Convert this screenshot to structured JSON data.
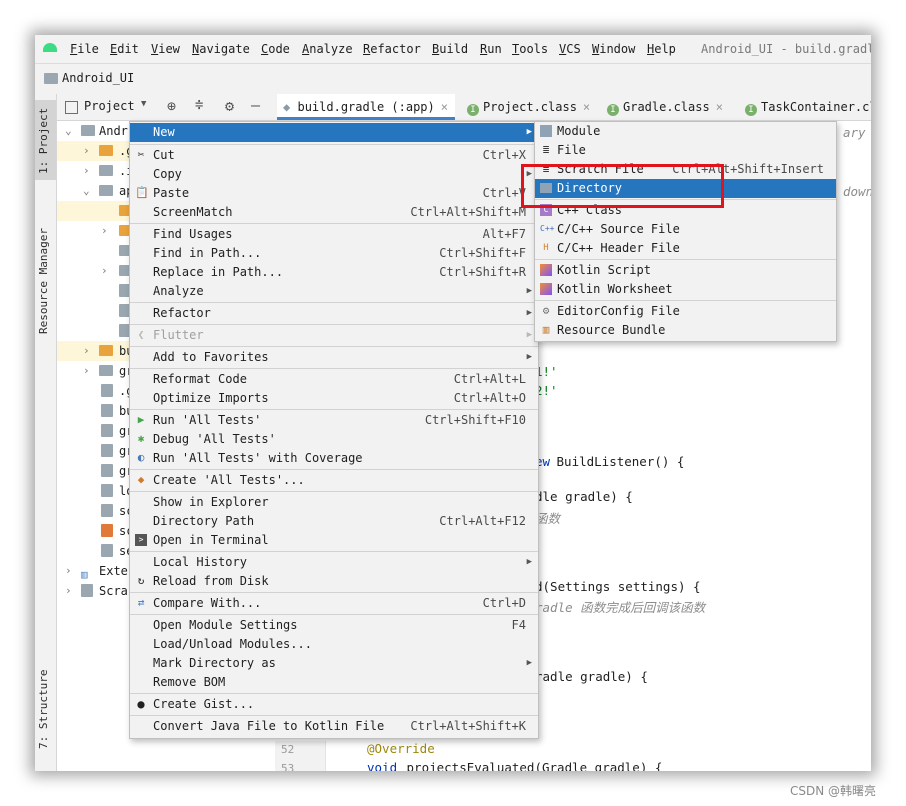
{
  "menubar": {
    "items": [
      "File",
      "Edit",
      "View",
      "Navigate",
      "Code",
      "Analyze",
      "Refactor",
      "Build",
      "Run",
      "Tools",
      "VCS",
      "Window",
      "Help"
    ],
    "window_title": "Android_UI - build.gradl"
  },
  "navbar": {
    "project_name": "Android_UI"
  },
  "left_stripe": {
    "project_tab": "1: Project",
    "resource_tab": "Resource Manager",
    "structure_tab": "7: Structure"
  },
  "project_toolbar": {
    "view_label": "Project"
  },
  "tabs": [
    {
      "label": "build.gradle (:app)",
      "icon": "gradle-icon"
    },
    {
      "label": "Project.class",
      "icon": "class-icon"
    },
    {
      "label": "Gradle.class",
      "icon": "class-icon"
    },
    {
      "label": "TaskContainer.cl",
      "icon": "class-icon"
    }
  ],
  "tree": {
    "root_label": "Andr",
    "rows": [
      "",
      ".g",
      ".i",
      "ap",
      "",
      "",
      "",
      "",
      "",
      "bu",
      "gr",
      ".g",
      "bu",
      "gr",
      "gr",
      "gr",
      "lo",
      "sc",
      "sc",
      "se",
      "Exte",
      "Scra"
    ]
  },
  "editor": {
    "lines": {
      "l1": "ary f",
      "l2": "down",
      "l3": "1!'",
      "l4": "2!'",
      "l5a": "ew",
      "l5b": " BuildListener() {",
      "l6": "dle gradle) {",
      "l7": "函数",
      "l8": "d(Settings settings) {",
      "l9": "radle 函数完成后回调该函数",
      "l10": "radle gradle) {",
      "l11": "@Override",
      "l12a": "void",
      "l12b": " projectsEvaluated(Gradle gradle) {"
    },
    "line_numbers": [
      "52",
      "53"
    ]
  },
  "context_menu": {
    "items": [
      {
        "label": "New",
        "shortcut": "",
        "submenu": true,
        "icon": ""
      },
      {
        "label": "Cut",
        "shortcut": "Ctrl+X",
        "icon": "scissors-icon"
      },
      {
        "label": "Copy",
        "shortcut": "",
        "submenu": true,
        "icon": ""
      },
      {
        "label": "Paste",
        "shortcut": "Ctrl+V",
        "icon": "clipboard-icon"
      },
      {
        "label": "ScreenMatch",
        "shortcut": "Ctrl+Alt+Shift+M",
        "icon": ""
      },
      {
        "label": "Find Usages",
        "shortcut": "Alt+F7",
        "icon": ""
      },
      {
        "label": "Find in Path...",
        "shortcut": "Ctrl+Shift+F",
        "icon": ""
      },
      {
        "label": "Replace in Path...",
        "shortcut": "Ctrl+Shift+R",
        "icon": ""
      },
      {
        "label": "Analyze",
        "shortcut": "",
        "submenu": true,
        "icon": ""
      },
      {
        "label": "Refactor",
        "shortcut": "",
        "submenu": true,
        "icon": ""
      },
      {
        "label": "Flutter",
        "shortcut": "",
        "submenu": true,
        "disabled": true,
        "icon": "flutter-icon"
      },
      {
        "label": "Add to Favorites",
        "shortcut": "",
        "submenu": true,
        "icon": ""
      },
      {
        "label": "Reformat Code",
        "shortcut": "Ctrl+Alt+L",
        "icon": ""
      },
      {
        "label": "Optimize Imports",
        "shortcut": "Ctrl+Alt+O",
        "icon": ""
      },
      {
        "label": "Run 'All Tests'",
        "shortcut": "Ctrl+Shift+F10",
        "icon": "run-icon"
      },
      {
        "label": "Debug 'All Tests'",
        "shortcut": "",
        "icon": "debug-icon"
      },
      {
        "label": "Run 'All Tests' with Coverage",
        "shortcut": "",
        "icon": "coverage-icon"
      },
      {
        "label": "Create 'All Tests'...",
        "shortcut": "",
        "icon": "create-test-icon"
      },
      {
        "label": "Show in Explorer",
        "shortcut": "",
        "icon": ""
      },
      {
        "label": "Directory Path",
        "shortcut": "Ctrl+Alt+F12",
        "icon": ""
      },
      {
        "label": "Open in Terminal",
        "shortcut": "",
        "icon": "terminal-icon"
      },
      {
        "label": "Local History",
        "shortcut": "",
        "submenu": true,
        "icon": ""
      },
      {
        "label": "Reload from Disk",
        "shortcut": "",
        "icon": "reload-icon"
      },
      {
        "label": "Compare With...",
        "shortcut": "Ctrl+D",
        "icon": "compare-icon"
      },
      {
        "label": "Open Module Settings",
        "shortcut": "F4",
        "icon": ""
      },
      {
        "label": "Load/Unload Modules...",
        "shortcut": "",
        "icon": ""
      },
      {
        "label": "Mark Directory as",
        "shortcut": "",
        "submenu": true,
        "icon": ""
      },
      {
        "label": "Remove BOM",
        "shortcut": "",
        "icon": ""
      },
      {
        "label": "Create Gist...",
        "shortcut": "",
        "icon": "github-icon"
      },
      {
        "label": "Convert Java File to Kotlin File",
        "shortcut": "Ctrl+Alt+Shift+K",
        "icon": ""
      }
    ]
  },
  "new_submenu": {
    "items": [
      {
        "label": "Module",
        "shortcut": "",
        "icon": "module-icon"
      },
      {
        "label": "File",
        "shortcut": "",
        "icon": "file-icon"
      },
      {
        "label": "Scratch File",
        "shortcut": "Ctrl+Alt+Shift+Insert",
        "icon": "scratch-icon"
      },
      {
        "label": "Directory",
        "shortcut": "",
        "icon": "folder-icon",
        "selected": true
      },
      {
        "label": "C++ Class",
        "shortcut": "",
        "icon": "cpp-class-icon"
      },
      {
        "label": "C/C++ Source File",
        "shortcut": "",
        "icon": "cpp-source-icon"
      },
      {
        "label": "C/C++ Header File",
        "shortcut": "",
        "icon": "cpp-header-icon"
      },
      {
        "label": "Kotlin Script",
        "shortcut": "",
        "icon": "kotlin-icon"
      },
      {
        "label": "Kotlin Worksheet",
        "shortcut": "",
        "icon": "kotlin-icon"
      },
      {
        "label": "EditorConfig File",
        "shortcut": "",
        "icon": "gear-icon"
      },
      {
        "label": "Resource Bundle",
        "shortcut": "",
        "icon": "bundle-icon"
      }
    ]
  },
  "watermark": "CSDN @韩曙亮",
  "colors": {
    "selection": "#2675bf",
    "highlight_box": "#e0141d",
    "folder": "#e8a33d"
  }
}
